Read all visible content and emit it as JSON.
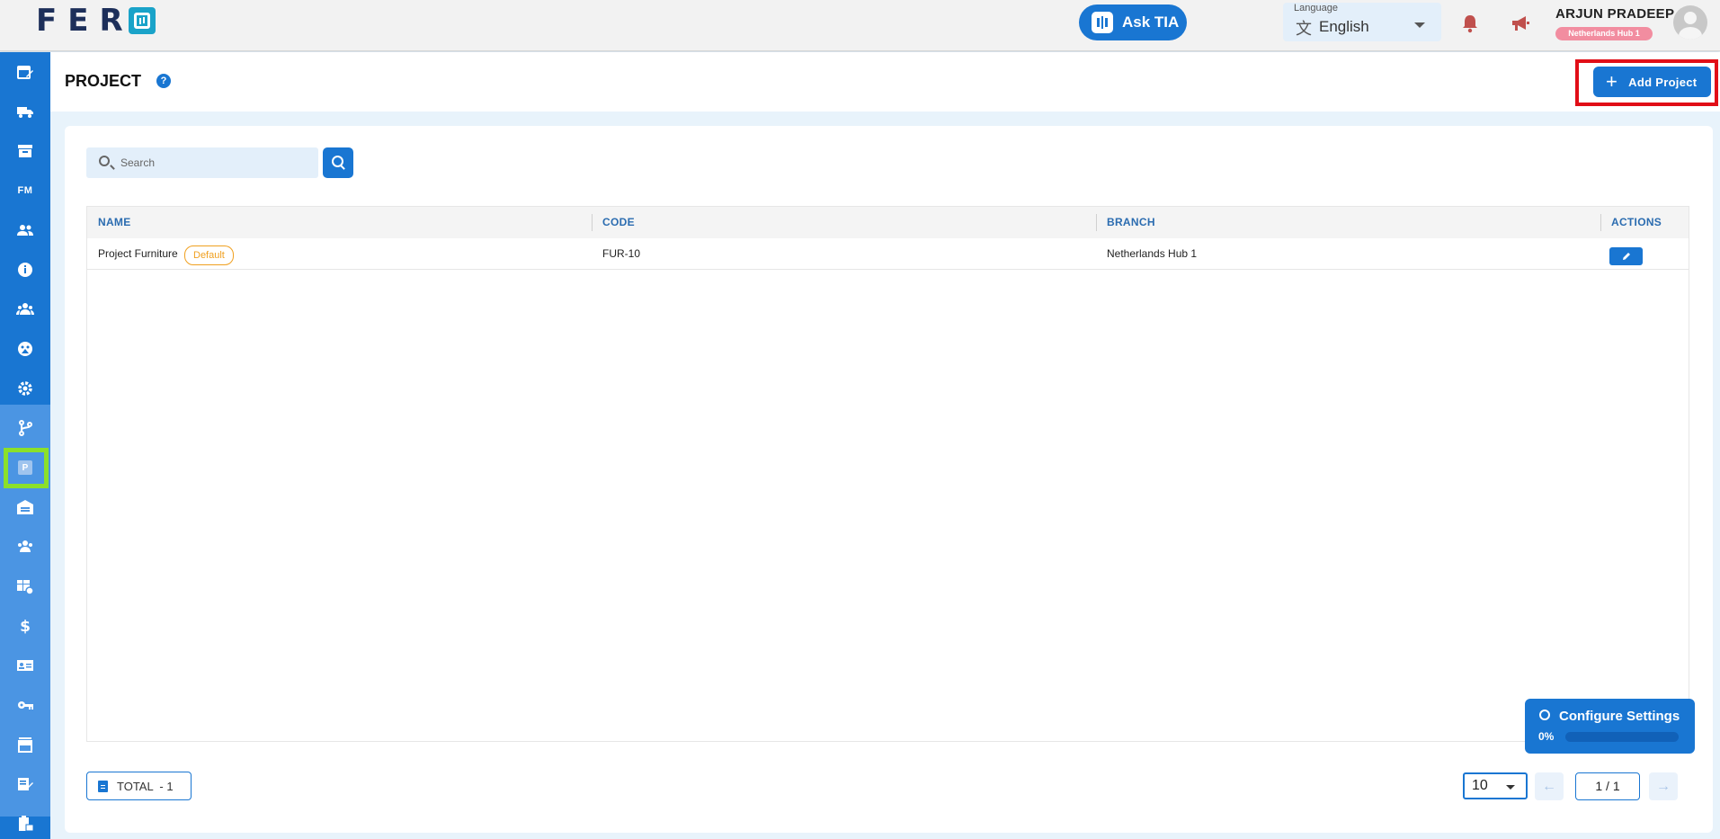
{
  "app": {
    "logo_text": "FER",
    "ask_tia_label": "Ask TIA",
    "language": {
      "caption": "Language",
      "value": "English"
    },
    "user": {
      "name": "ARJUN PRADEEP",
      "branch": "Netherlands Hub 1"
    }
  },
  "sidebar": {
    "items": [
      {
        "icon": "calendar-edit-icon"
      },
      {
        "icon": "delivery-truck-icon"
      },
      {
        "icon": "archive-icon"
      },
      {
        "icon": "fm-text-icon",
        "label": "FM"
      },
      {
        "icon": "people-icon"
      },
      {
        "icon": "info-icon"
      },
      {
        "icon": "groups-icon"
      },
      {
        "icon": "dashboard-icon"
      },
      {
        "icon": "settings-icon"
      },
      {
        "icon": "branch-fork-icon"
      },
      {
        "icon": "project-p-icon",
        "label": "P"
      },
      {
        "icon": "warehouse-icon"
      },
      {
        "icon": "team-icon"
      },
      {
        "icon": "table-settings-icon"
      },
      {
        "icon": "dollar-icon"
      },
      {
        "icon": "id-card-icon"
      },
      {
        "icon": "key-icon"
      },
      {
        "icon": "store-icon"
      },
      {
        "icon": "edit-note-icon"
      },
      {
        "icon": "clipboard-lock-icon"
      }
    ]
  },
  "page": {
    "title": "PROJECT",
    "help_icon": "?",
    "add_button_label": "Add Project",
    "add_button_icon": "+"
  },
  "search": {
    "placeholder": "Search"
  },
  "table": {
    "columns": [
      "NAME",
      "CODE",
      "BRANCH",
      "ACTIONS"
    ],
    "rows": [
      {
        "name": "Project Furniture",
        "badge": "Default",
        "code": "FUR-10",
        "branch": "Netherlands Hub 1"
      }
    ]
  },
  "footer": {
    "total_label": "TOTAL  - 1",
    "page_size": "10",
    "page_indicator": "1 / 1",
    "prev_icon": "←",
    "next_icon": "→"
  },
  "config_widget": {
    "label": "Configure Settings",
    "progress_text": "0%",
    "progress": 0
  },
  "colors": {
    "primary": "#1976d2",
    "sidebar_sub": "#4b95e3",
    "highlight_red": "#e10e17",
    "highlight_green": "#8be02a",
    "badge_orange": "#f0a020",
    "branch_pill": "#f28da0"
  }
}
